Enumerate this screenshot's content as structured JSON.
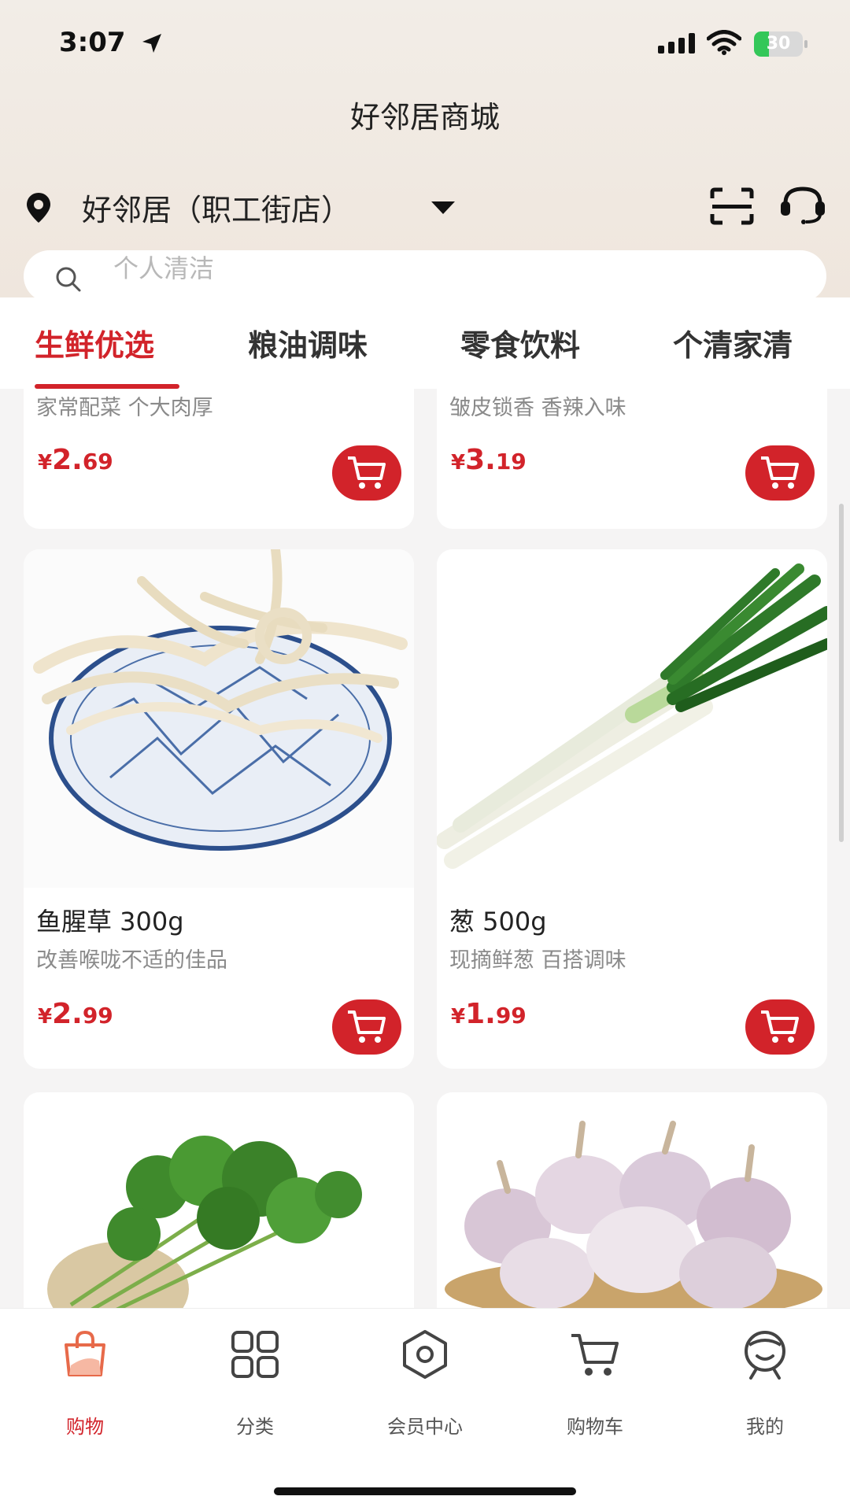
{
  "status_bar": {
    "time": "3:07",
    "battery": "30",
    "battery_level": 0.3,
    "icons": [
      "location-arrow-icon",
      "signal-icon",
      "wifi-icon",
      "battery-icon"
    ]
  },
  "header": {
    "title": "好邻居商城",
    "store": "好邻居（职工街店）",
    "icons": [
      "pin-icon",
      "dropdown-caret-icon",
      "scan-icon",
      "customer-service-icon"
    ]
  },
  "search": {
    "placeholder": "个人清洁"
  },
  "tabs": [
    {
      "label": "生鲜优选",
      "active": true
    },
    {
      "label": "粮油调味",
      "active": false
    },
    {
      "label": "零食饮料",
      "active": false
    },
    {
      "label": "个清家清",
      "active": false
    }
  ],
  "products": [
    {
      "title": "",
      "desc": "家常配菜 个大肉厚",
      "currency": "¥",
      "price_int": "2.",
      "price_dec": "69"
    },
    {
      "title": "",
      "desc": "皱皮锁香 香辣入味",
      "currency": "¥",
      "price_int": "3.",
      "price_dec": "19"
    },
    {
      "title": "鱼腥草 300g",
      "desc": "改善喉咙不适的佳品",
      "currency": "¥",
      "price_int": "2.",
      "price_dec": "99",
      "image": "herb-roots-on-plate"
    },
    {
      "title": "葱 500g",
      "desc": "现摘鲜葱 百搭调味",
      "currency": "¥",
      "price_int": "1.",
      "price_dec": "99",
      "image": "green-onions"
    },
    {
      "title": "",
      "desc": "",
      "image": "cilantro"
    },
    {
      "title": "",
      "desc": "",
      "image": "garlic-basket"
    }
  ],
  "bottom_nav": [
    {
      "label": "购物",
      "icon": "shopping-bag-icon",
      "active": true
    },
    {
      "label": "分类",
      "icon": "grid-icon",
      "active": false
    },
    {
      "label": "会员中心",
      "icon": "hexagon-icon",
      "active": false
    },
    {
      "label": "购物车",
      "icon": "cart-icon",
      "active": false
    },
    {
      "label": "我的",
      "icon": "profile-icon",
      "active": false
    }
  ],
  "colors": {
    "accent": "#d2232a",
    "header_bg": "#efe6dd",
    "nav_active": "#d2232a"
  }
}
